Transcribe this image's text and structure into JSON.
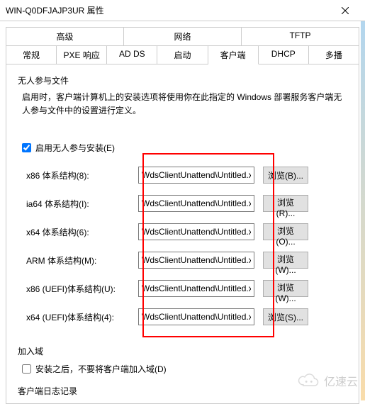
{
  "window": {
    "title": "WIN-Q0DFJAJP3UR 属性"
  },
  "tabs": {
    "top": [
      "高级",
      "网络",
      "TFTP"
    ],
    "bottom": [
      "常规",
      "PXE 响应",
      "AD DS",
      "启动",
      "客户端",
      "DHCP",
      "多播"
    ],
    "active": "客户端"
  },
  "group": {
    "title": "无人参与文件",
    "desc": "启用时，客户端计算机上的安装选项将使用你在此指定的 Windows 部署服务客户端无人参与文件中的设置进行定义。",
    "checkbox_label": "启用无人参与安装(E)",
    "checkbox_checked": true,
    "rows": [
      {
        "label": "x86 体系结构(8):",
        "value": "WdsClientUnattend\\Untitled.x",
        "browse": "浏览(B)..."
      },
      {
        "label": "ia64 体系结构(I):",
        "value": "WdsClientUnattend\\Untitled.x",
        "browse": "浏览(R)..."
      },
      {
        "label": "x64 体系结构(6):",
        "value": "WdsClientUnattend\\Untitled.x",
        "browse": "浏览(O)..."
      },
      {
        "label": "ARM 体系结构(M):",
        "value": "WdsClientUnattend\\Untitled.x",
        "browse": "浏览(W)..."
      },
      {
        "label": "x86 (UEFI)体系结构(U):",
        "value": "WdsClientUnattend\\Untitled.x",
        "browse": "浏览(W)..."
      },
      {
        "label": "x64 (UEFI)体系结构(4):",
        "value": "WdsClientUnattend\\Untitled.x",
        "browse": "浏览(S)..."
      }
    ]
  },
  "join": {
    "title": "加入域",
    "checkbox_label": "安装之后，不要将客户端加入域(D)",
    "checkbox_checked": false
  },
  "log": {
    "title": "客户端日志记录"
  },
  "watermark": {
    "text": "亿速云"
  }
}
